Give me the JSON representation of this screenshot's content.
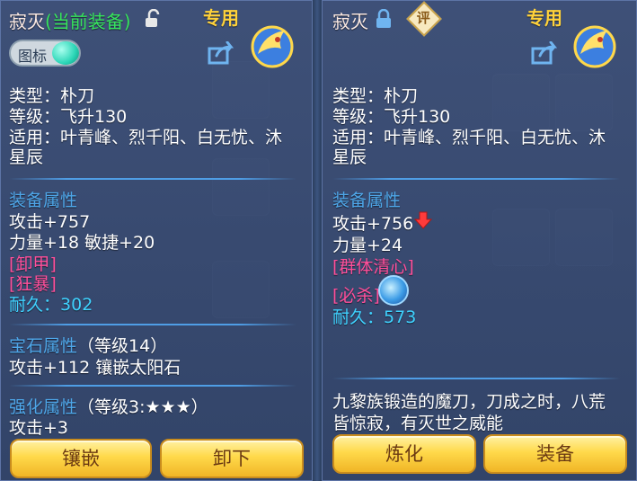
{
  "left": {
    "name": "寂灭",
    "equipped_tag": "(当前装备)",
    "exclusive_tag": "专用",
    "icon_toggle_label": "图标",
    "type": "类型：朴刀",
    "level": "等级：飞升130",
    "suits": "适用：叶青峰、烈千阳、白无忧、沐",
    "suits_cont": "星辰",
    "attr_header": "装备属性",
    "attack": "攻击+757",
    "strength_agility": "力量+18 敏捷+20",
    "special1": "[卸甲]",
    "special2": "[狂暴]",
    "durability_label": "耐久：",
    "durability_value": "302",
    "gem_header": "宝石属性",
    "gem_level": "（等级14）",
    "gem_bonus": "攻击+112 镶嵌太阳石",
    "enhance_header": "强化属性",
    "enhance_level": "（等级3:★★★）",
    "enhance_bonus": "攻击+3",
    "btn_inlay": "镶嵌",
    "btn_unequip": "卸下"
  },
  "right": {
    "name": "寂灭",
    "rate_badge": "评",
    "exclusive_tag": "专用",
    "type": "类型：朴刀",
    "level": "等级：飞升130",
    "suits": "适用：叶青峰、烈千阳、白无忧、沐",
    "suits_cont": "星辰",
    "attr_header": "装备属性",
    "attack": "攻击+756",
    "strength": "力量+24",
    "special1": "[群体清心]",
    "special2": "[必杀]",
    "durability_label": "耐久：",
    "durability_value": "573",
    "desc_line1": "九黎族锻造的魔刀，刀成之时，八荒",
    "desc_line2": "皆惊寂，有灭世之威能",
    "btn_refine": "炼化",
    "btn_equip": "装备"
  },
  "colors": {
    "equipped_green": "#37e45d",
    "durability_cyan": "#3fd2ff",
    "header_blue": "#4ea6e8",
    "special_pink": "#ff4f9a",
    "exclusive_gold": "#ffd23a",
    "button_gold": "#ffd94a"
  },
  "icons": [
    "lock-open-icon",
    "lock-icon",
    "share-icon",
    "dragon-emblem-icon",
    "red-down-arrow-icon",
    "skill-swirl-icon"
  ]
}
